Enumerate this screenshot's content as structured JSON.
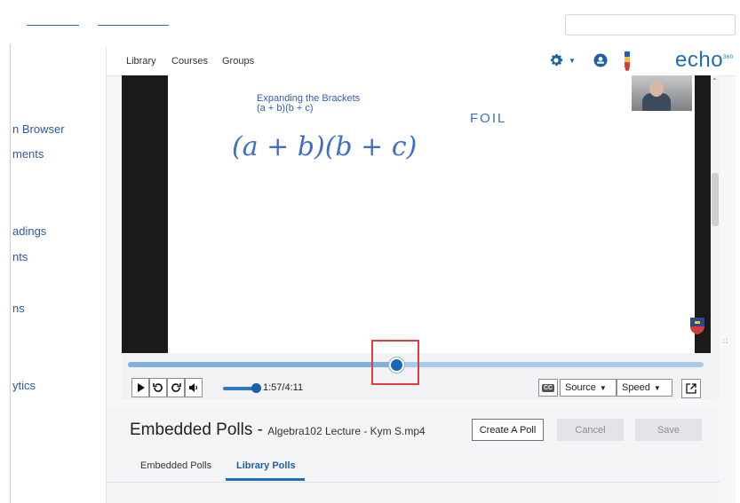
{
  "lms_sidebar": {
    "links": [
      "n Browser",
      "ments",
      "adings",
      "nts",
      "ns",
      "ytics"
    ]
  },
  "echo": {
    "nav": {
      "library": "Library",
      "courses": "Courses",
      "groups": "Groups"
    },
    "logo": "echo",
    "logo_suffix": "360"
  },
  "video": {
    "board_title": "Expanding the Brackets",
    "board_expression": "(a + b)(b + c)",
    "handwritten_expression": "(a + b)(b + c)",
    "handwritten_note": "FOIL"
  },
  "player": {
    "current_time": "1:57",
    "duration": "4:11",
    "time_display": "1:57/4:11",
    "progress_fraction": 0.466,
    "volume_fraction": 1.0,
    "cc_label": "CC",
    "source_label": "Source",
    "speed_label": "Speed"
  },
  "polls": {
    "title": "Embedded Polls - ",
    "subtitle": "Algebra102 Lecture - Kym S.mp4",
    "create_label": "Create A Poll",
    "cancel_label": "Cancel",
    "save_label": "Save",
    "tabs": [
      {
        "label": "Embedded Polls",
        "active": false
      },
      {
        "label": "Library Polls",
        "active": true
      }
    ]
  },
  "colors": {
    "accent": "#1b6fb8",
    "link": "#2c5aa0",
    "highlight": "#e03c3c"
  }
}
